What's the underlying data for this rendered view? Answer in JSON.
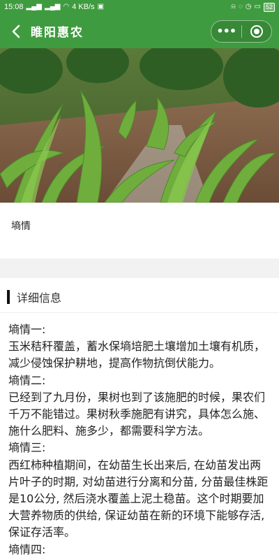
{
  "status_bar": {
    "time": "15:08",
    "speed": "4 KB/s",
    "battery": "52"
  },
  "nav": {
    "title": "睢阳惠农"
  },
  "post": {
    "title": "墒情"
  },
  "section": {
    "label": "详细信息"
  },
  "content": {
    "lines": [
      "墒情一:",
      "玉米秸秆覆盖，蓄水保墒培肥土壤增加土壤有机质，减少侵蚀保护耕地，提高作物抗倒伏能力。",
      "墒情二:",
      "已经到了九月份，果树也到了该施肥的时候，果农们千万不能错过。果树秋季施肥有讲究，具体怎么施、施什么肥料、施多少，都需要科学方法。",
      "墒情三:",
      "西红柿种植期间，在幼苗生长出来后, 在幼苗发出两片叶子的时期, 对幼苗进行分离和分苗, 分苗最佳株距是10公分, 然后浇水覆盖上泥土稳苗。这个时期要加大营养物质的供给, 保证幼苗在新的环境下能够存活, 保证存活率。",
      "墒情四:"
    ]
  },
  "colors": {
    "header_green": "#3f9b3f",
    "divider_gray": "#f2f2f2"
  },
  "icons": [
    "back-arrow-icon",
    "more-dots-icon",
    "close-target-icon",
    "signal-icon",
    "wifi-icon",
    "alarm-icon",
    "battery-icon"
  ]
}
